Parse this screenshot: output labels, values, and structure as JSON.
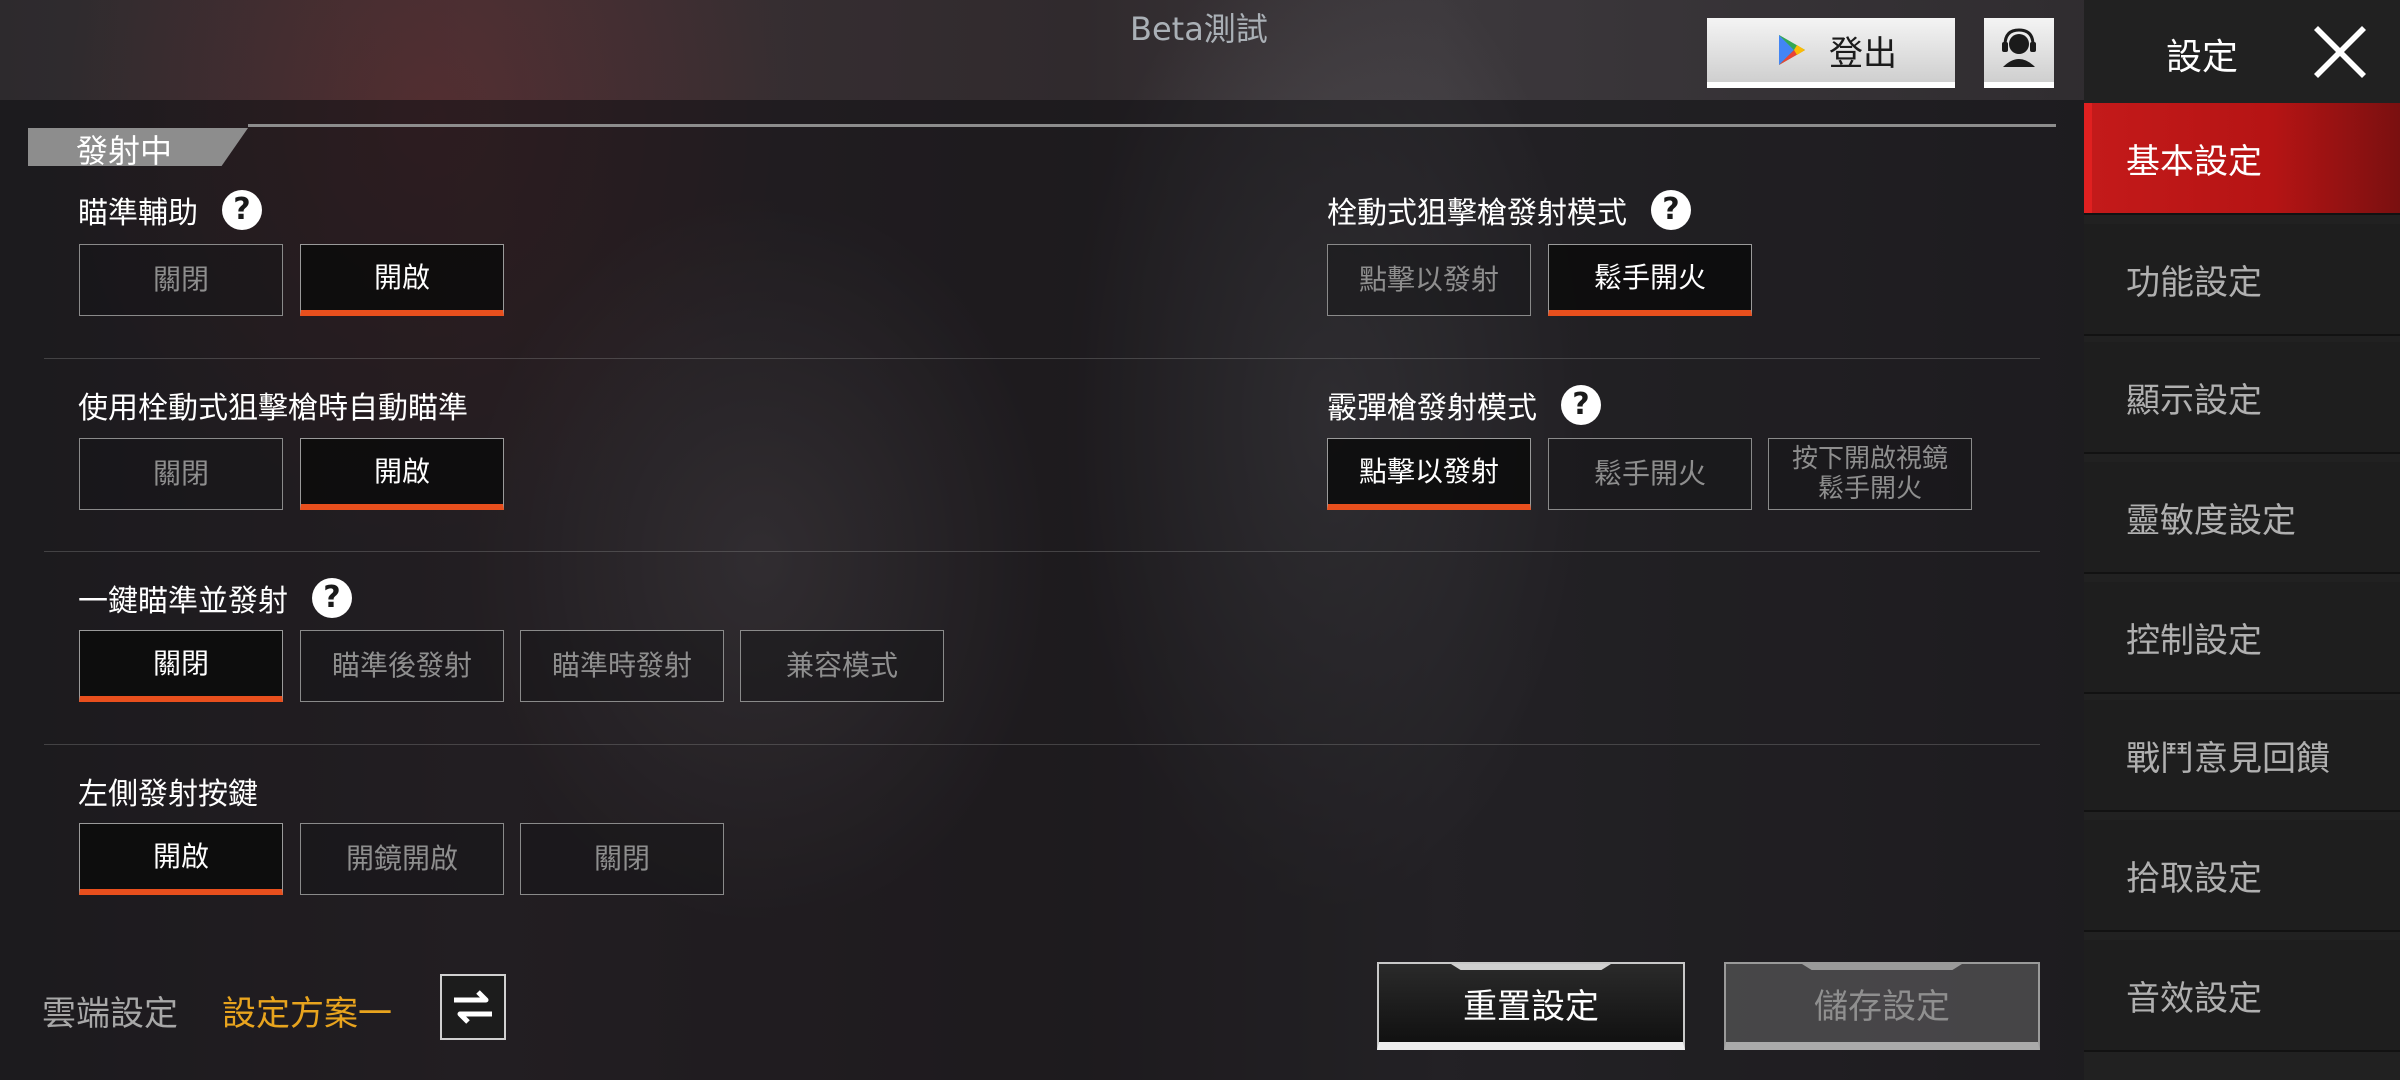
{
  "header": {
    "beta_label": "Beta測試",
    "logout_label": "登出",
    "logout_icon": "google-play-icon",
    "support_icon": "support-headset-icon"
  },
  "section": {
    "title": "發射中"
  },
  "settings": {
    "aim_assist": {
      "label": "瞄準輔助",
      "options": [
        "關閉",
        "開啟"
      ],
      "selected": "開啟"
    },
    "bolt_auto_aim": {
      "label": "使用栓動式狙擊槍時自動瞄準",
      "options": [
        "關閉",
        "開啟"
      ],
      "selected": "開啟"
    },
    "one_key_aim_fire": {
      "label": "一鍵瞄準並發射",
      "options": [
        "關閉",
        "瞄準後發射",
        "瞄準時發射",
        "兼容模式"
      ],
      "selected": "關閉"
    },
    "left_fire_button": {
      "label": "左側發射按鍵",
      "options": [
        "開啟",
        "開鏡開啟",
        "關閉"
      ],
      "selected": "開啟"
    },
    "bolt_fire_mode": {
      "label": "栓動式狙擊槍發射模式",
      "options": [
        "點擊以發射",
        "鬆手開火"
      ],
      "selected": "鬆手開火"
    },
    "shotgun_fire_mode": {
      "label": "霰彈槍發射模式",
      "options": [
        "點擊以發射",
        "鬆手開火",
        "按下開啟視鏡 鬆手開火"
      ],
      "selected": "點擊以發射"
    }
  },
  "footer": {
    "cloud_label": "雲端設定",
    "scheme_label": "設定方案一",
    "reset_label": "重置設定",
    "save_label": "儲存設定"
  },
  "sidebar": {
    "title": "設定",
    "items": [
      {
        "label": "基本設定",
        "active": true
      },
      {
        "label": "功能設定",
        "active": false
      },
      {
        "label": "顯示設定",
        "active": false
      },
      {
        "label": "靈敏度設定",
        "active": false
      },
      {
        "label": "控制設定",
        "active": false
      },
      {
        "label": "戰鬥意見回饋",
        "active": false
      },
      {
        "label": "拾取設定",
        "active": false
      },
      {
        "label": "音效設定",
        "active": false
      }
    ]
  },
  "colors": {
    "accent": "#e84f1d",
    "sidebar_active": "#c41a1a",
    "scheme_text": "#e8a41e"
  }
}
